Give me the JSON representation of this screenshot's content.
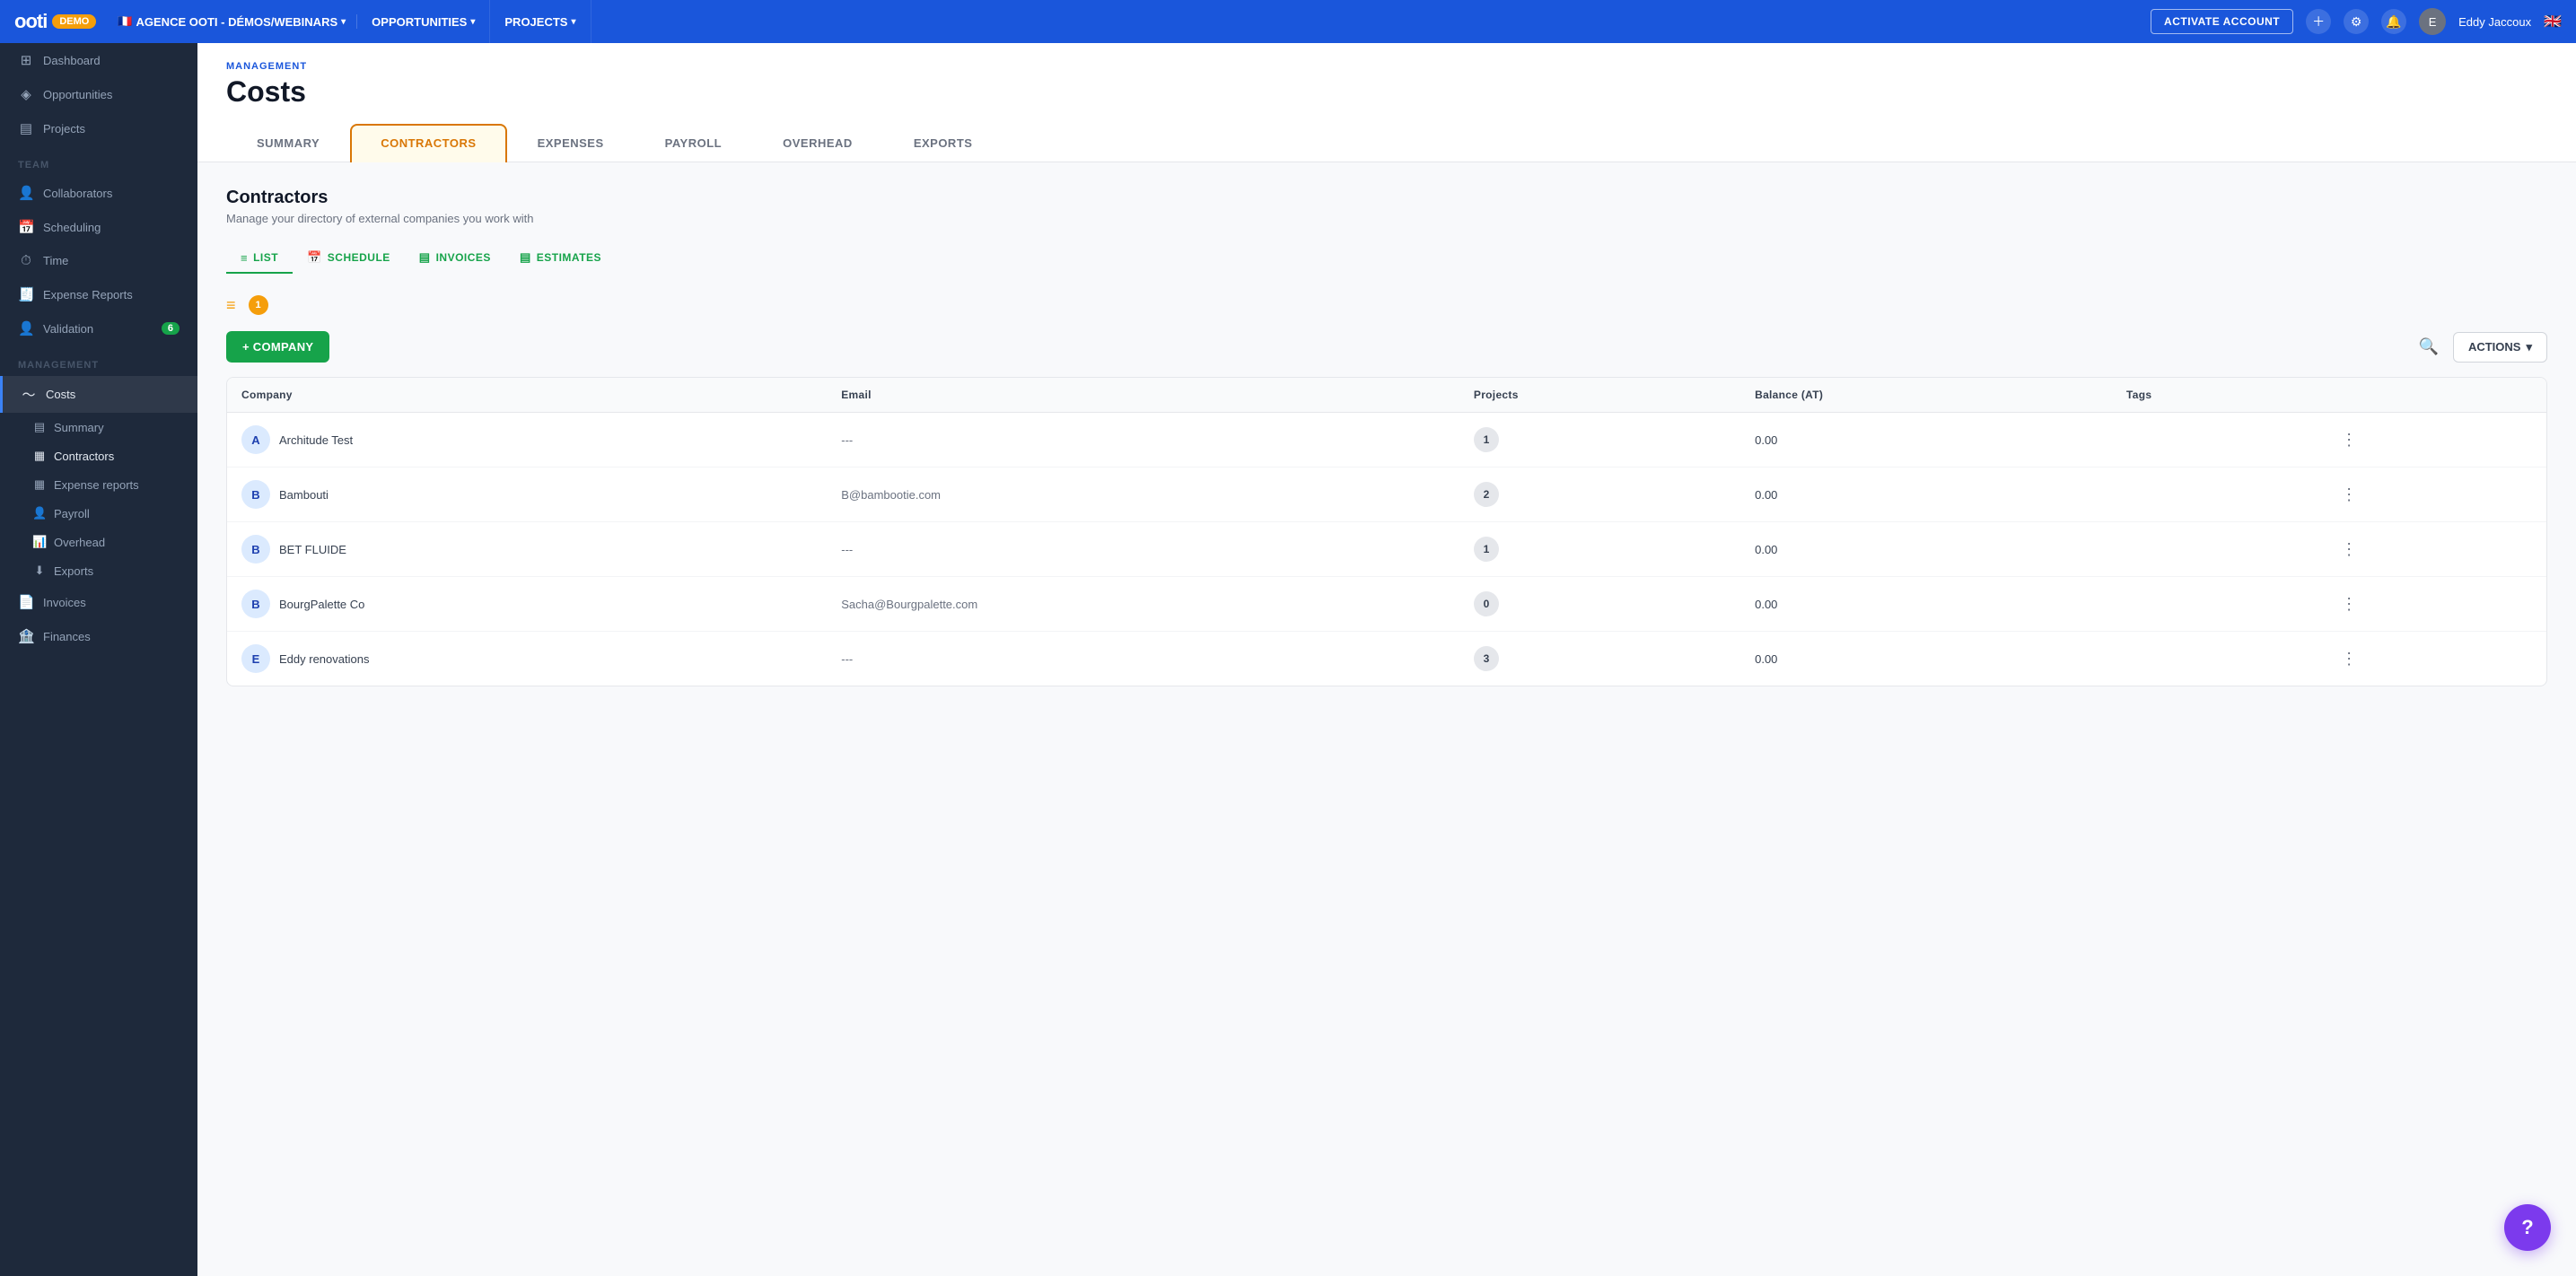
{
  "topnav": {
    "logo": "ooti",
    "demo_badge": "DEMO",
    "flag": "🇫🇷",
    "agency": "AGENCE OOTI - DÉMOS/WEBINARS",
    "nav_items": [
      {
        "label": "OPPORTUNITIES",
        "has_chevron": true
      },
      {
        "label": "PROJECTS",
        "has_chevron": true
      }
    ],
    "activate_btn": "ACTIVATE ACCOUNT",
    "user_name": "Eddy Jaccoux",
    "flag_right": "🇬🇧"
  },
  "sidebar": {
    "top_items": [
      {
        "label": "Dashboard",
        "icon": "⊞"
      },
      {
        "label": "Opportunities",
        "icon": "◈"
      },
      {
        "label": "Projects",
        "icon": "▤"
      }
    ],
    "team_section": "TEAM",
    "team_items": [
      {
        "label": "Collaborators",
        "icon": "👤"
      },
      {
        "label": "Scheduling",
        "icon": "📅"
      },
      {
        "label": "Time",
        "icon": "⏱"
      },
      {
        "label": "Expense Reports",
        "icon": "🧾"
      },
      {
        "label": "Validation",
        "icon": "👤",
        "badge": "6"
      }
    ],
    "management_section": "MANAGEMENT",
    "management_items": [
      {
        "label": "Costs",
        "icon": "~",
        "active": true
      }
    ],
    "costs_sub_items": [
      {
        "label": "Summary",
        "icon": "▤"
      },
      {
        "label": "Contractors",
        "icon": "▦",
        "active": true
      },
      {
        "label": "Expense reports",
        "icon": "▦"
      },
      {
        "label": "Payroll",
        "icon": "👤"
      },
      {
        "label": "Overhead",
        "icon": "📊"
      },
      {
        "label": "Exports",
        "icon": "⬇"
      }
    ],
    "bottom_items": [
      {
        "label": "Invoices",
        "icon": "📄"
      },
      {
        "label": "Finances",
        "icon": "🏦"
      }
    ]
  },
  "header": {
    "management_label": "MANAGEMENT",
    "page_title": "Costs"
  },
  "tabs": [
    {
      "label": "SUMMARY",
      "active": false
    },
    {
      "label": "CONTRACTORS",
      "active": true
    },
    {
      "label": "EXPENSES",
      "active": false
    },
    {
      "label": "PAYROLL",
      "active": false
    },
    {
      "label": "OVERHEAD",
      "active": false
    },
    {
      "label": "EXPORTS",
      "active": false
    }
  ],
  "contractors_section": {
    "title": "Contractors",
    "description": "Manage your directory of external companies you work with",
    "subtabs": [
      {
        "label": "LIST",
        "icon": "≡",
        "active": true
      },
      {
        "label": "SCHEDULE",
        "icon": "📅",
        "active": false
      },
      {
        "label": "INVOICES",
        "icon": "▤",
        "active": false
      },
      {
        "label": "ESTIMATES",
        "icon": "▤",
        "active": false
      }
    ],
    "filter_count": "1",
    "add_company_btn": "+ COMPANY",
    "actions_btn": "ACTIONS",
    "table": {
      "columns": [
        "Company",
        "Email",
        "Projects",
        "Balance (AT)",
        "Tags"
      ],
      "rows": [
        {
          "initial": "A",
          "company": "Architude Test",
          "email": "---",
          "projects": "1",
          "balance": "0.00",
          "color": "blue"
        },
        {
          "initial": "B",
          "company": "Bambouti",
          "email": "B@bambootie.com",
          "projects": "2",
          "balance": "0.00",
          "color": "blue"
        },
        {
          "initial": "B",
          "company": "BET FLUIDE",
          "email": "---",
          "projects": "1",
          "balance": "0.00",
          "color": "blue"
        },
        {
          "initial": "B",
          "company": "BourgPalette Co",
          "email": "Sacha@Bourgpalette.com",
          "projects": "0",
          "balance": "0.00",
          "color": "blue"
        },
        {
          "initial": "E",
          "company": "Eddy renovations",
          "email": "---",
          "projects": "3",
          "balance": "0.00",
          "color": "blue"
        }
      ]
    }
  },
  "fab": {
    "label": "?"
  }
}
